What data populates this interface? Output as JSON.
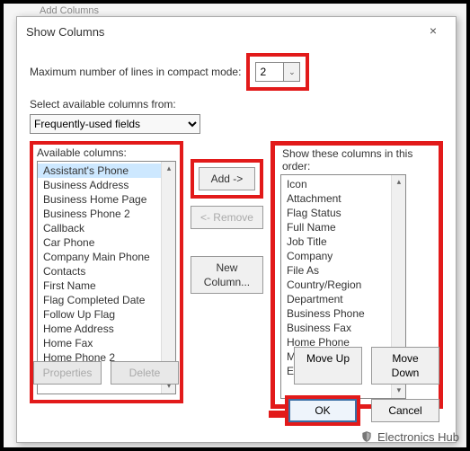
{
  "ribbon_hint": "Add Columns",
  "dialog": {
    "title": "Show Columns",
    "close": "×",
    "compact_label": "Maximum number of lines in compact mode:",
    "compact_value": "2",
    "select_label": "Select available columns from:",
    "select_value": "Frequently-used fields",
    "available_label": "Available columns:",
    "available_items": [
      "Assistant's Phone",
      "Business Address",
      "Business Home Page",
      "Business Phone 2",
      "Callback",
      "Car Phone",
      "Company Main Phone",
      "Contacts",
      "First Name",
      "Flag Completed Date",
      "Follow Up Flag",
      "Home Address",
      "Home Fax",
      "Home Phone 2"
    ],
    "show_label": "Show these columns in this order:",
    "show_items": [
      "Icon",
      "Attachment",
      "Flag Status",
      "Full Name",
      "Job Title",
      "Company",
      "File As",
      "Country/Region",
      "Department",
      "Business Phone",
      "Business Fax",
      "Home Phone",
      "Mobile Phone",
      "Email"
    ],
    "add_btn": "Add ->",
    "remove_btn": "<- Remove",
    "newcol_btn": "New Column...",
    "moveup_btn": "Move Up",
    "movedown_btn": "Move Down",
    "properties_btn": "Properties",
    "delete_btn": "Delete",
    "ok_btn": "OK",
    "cancel_btn": "Cancel"
  },
  "watermark": "Electronics Hub"
}
